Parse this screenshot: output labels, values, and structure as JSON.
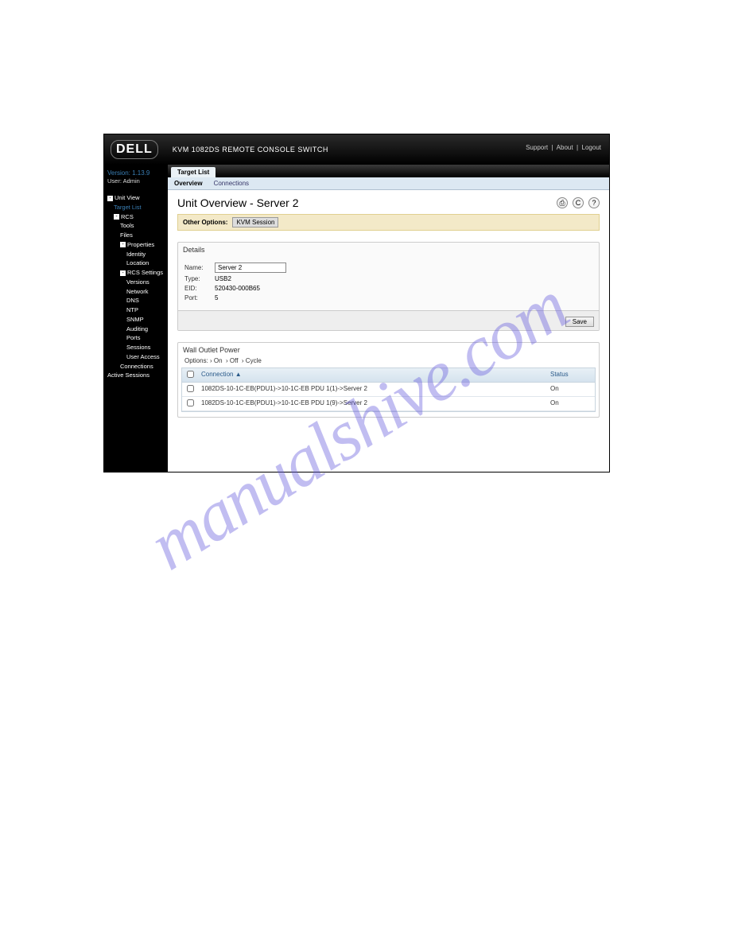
{
  "brand": "DELL",
  "product_title": "KVM 1082DS REMOTE CONSOLE SWITCH",
  "header_links": {
    "support": "Support",
    "about": "About",
    "logout": "Logout"
  },
  "sidebar": {
    "version_label": "Version: 1.13.9",
    "user_label": "User: Admin",
    "nodes": {
      "unit_view": "Unit View",
      "target_list": "Target List",
      "rcs": "RCS",
      "tools": "Tools",
      "files": "Files",
      "properties": "Properties",
      "identity": "Identity",
      "location": "Location",
      "rcs_settings": "RCS Settings",
      "versions": "Versions",
      "network": "Network",
      "dns": "DNS",
      "ntp": "NTP",
      "snmp": "SNMP",
      "auditing": "Auditing",
      "ports": "Ports",
      "sessions": "Sessions",
      "user_access": "User Access",
      "connections": "Connections",
      "active_sessions": "Active Sessions"
    }
  },
  "tabs": {
    "target_list": "Target List"
  },
  "subtabs": {
    "overview": "Overview",
    "connections": "Connections"
  },
  "page_title": "Unit Overview - Server 2",
  "other_options": {
    "label": "Other Options:",
    "kvm_session": "KVM Session"
  },
  "details": {
    "title": "Details",
    "name_label": "Name:",
    "name_value": "Server 2",
    "type_label": "Type:",
    "type_value": "USB2",
    "eid_label": "EID:",
    "eid_value": "520430-000B65",
    "port_label": "Port:",
    "port_value": "5",
    "save_label": "Save"
  },
  "wall_outlet": {
    "title": "Wall Outlet Power",
    "options_label": "Options:",
    "on": "On",
    "off": "Off",
    "cycle": "Cycle",
    "col_connection": "Connection",
    "col_status": "Status",
    "rows": [
      {
        "connection": "1082DS-10-1C-EB(PDU1)->10-1C-EB PDU 1(1)->Server 2",
        "status": "On"
      },
      {
        "connection": "1082DS-10-1C-EB(PDU1)->10-1C-EB PDU 1(9)->Server 2",
        "status": "On"
      }
    ]
  },
  "watermark": "manualshive.com"
}
